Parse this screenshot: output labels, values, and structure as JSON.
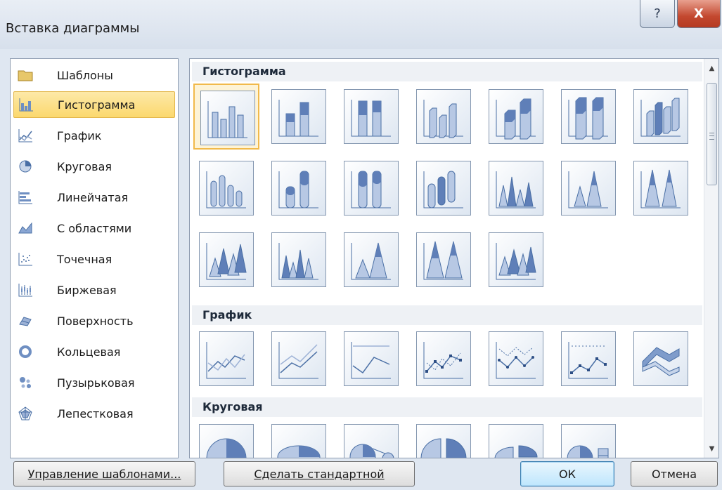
{
  "window": {
    "title": "Вставка диаграммы",
    "help_label": "?",
    "close_label": "X"
  },
  "categories": [
    {
      "label": "Шаблоны",
      "icon": "folder-icon"
    },
    {
      "label": "Гистограмма",
      "icon": "column-chart-icon",
      "selected": true
    },
    {
      "label": "График",
      "icon": "line-chart-icon"
    },
    {
      "label": "Круговая",
      "icon": "pie-chart-icon"
    },
    {
      "label": "Линейчатая",
      "icon": "bar-chart-icon"
    },
    {
      "label": "С областями",
      "icon": "area-chart-icon"
    },
    {
      "label": "Точечная",
      "icon": "scatter-chart-icon"
    },
    {
      "label": "Биржевая",
      "icon": "stock-chart-icon"
    },
    {
      "label": "Поверхность",
      "icon": "surface-chart-icon"
    },
    {
      "label": "Кольцевая",
      "icon": "doughnut-chart-icon"
    },
    {
      "label": "Пузырьковая",
      "icon": "bubble-chart-icon"
    },
    {
      "label": "Лепестковая",
      "icon": "radar-chart-icon"
    }
  ],
  "sections": [
    {
      "title": "Гистограмма",
      "thumb_count": 19
    },
    {
      "title": "График",
      "thumb_count": 7
    },
    {
      "title": "Круговая",
      "thumb_count": 6
    }
  ],
  "buttons": {
    "manage_templates": "Управление шаблонами...",
    "set_default": "Сделать стандартной",
    "ok": "ОК",
    "cancel": "Отмена"
  },
  "colors": {
    "selection_fill": "#fbd86e",
    "selection_border": "#e3b64a",
    "accent_blue": "#4a6fa5"
  }
}
